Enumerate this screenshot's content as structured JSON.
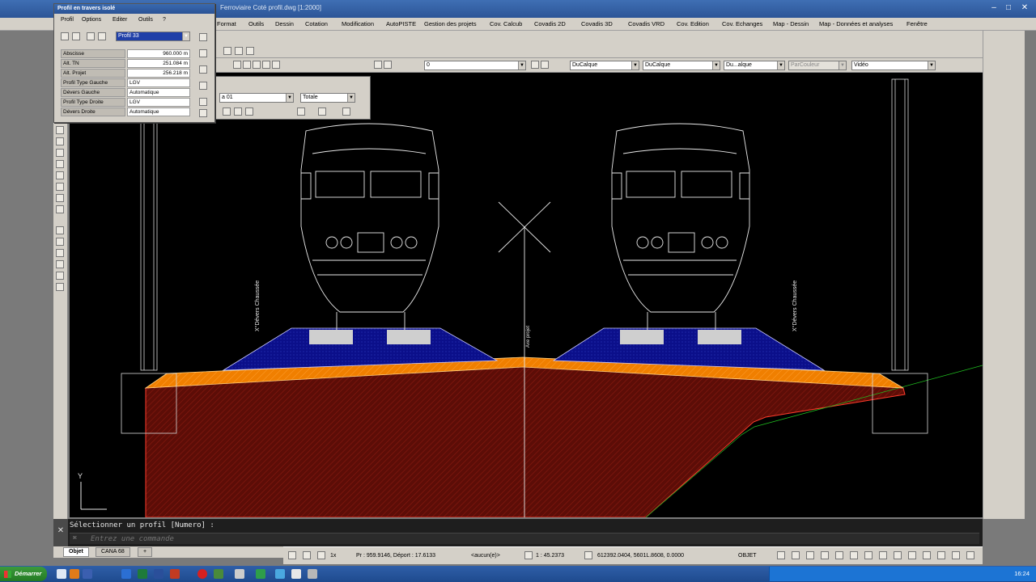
{
  "window": {
    "title": "Ferroviaire Coté profil.dwg [1:2000]",
    "minimize": "–",
    "maximize": "□",
    "close": "✕"
  },
  "menu": [
    "Format",
    "Outils",
    "Dessin",
    "Cotation",
    "Modification",
    "AutoPISTE",
    "Gestion des projets",
    "Cov. Calcub",
    "Covadis 2D",
    "Covadis 3D",
    "Covadis VRD",
    "Cov. Edition",
    "Cov. Echanges",
    "Map - Dessin",
    "Map - Données et analyses",
    "Fenêtre"
  ],
  "toolbar": {
    "layer_combo": "0",
    "color_combo": "DuCalque",
    "linetype_combo": "DuCalque",
    "lineweight_combo": "Du...alque",
    "plotstyle_combo": "ParCouleur",
    "view_combo": "Vidéo"
  },
  "floattb": {
    "combo1": "a 01",
    "combo2": "Totale"
  },
  "profil_panel": {
    "title": "Profil en travers isolé",
    "menu": [
      "Profil",
      "Options",
      "Editer",
      "Outils",
      "?"
    ],
    "profile_combo": "Profil 33",
    "rows": [
      {
        "label": "Abscisse",
        "value": "960.000 m"
      },
      {
        "label": "Alt. TN",
        "value": "251.084 m"
      },
      {
        "label": "Alt. Projet",
        "value": "256.218 m"
      },
      {
        "label": "Profil Type Gauche",
        "value": "LGV"
      },
      {
        "label": "Dévers Gauche",
        "value": "Automatique"
      },
      {
        "label": "Profil Type Droite",
        "value": "LGV"
      },
      {
        "label": "Dévers Droite",
        "value": "Automatique"
      }
    ]
  },
  "drawing": {
    "label_center": "Axe projet",
    "label_left": "X°Dévers Chaussée",
    "label_right": "X°Dévers Chaussée",
    "axis_y": "Y"
  },
  "command": {
    "history": "Sélectionner un profil [Numero] :",
    "prompt": "⌘",
    "placeholder": "Entrez une commande"
  },
  "tabs": [
    "Objet",
    "CANA 68",
    "+"
  ],
  "status": {
    "scale": "1x",
    "coords_pm": "Pr : 959.9146, Déport : 17.6133",
    "snap": "<aucun(e)>",
    "zoom": "1 : 45.2373",
    "coords": "612392.0404, 5601L.8608, 0.0000",
    "mode": "OBJET"
  },
  "taskbar": {
    "start": "Démarrer",
    "clock": "16:24"
  },
  "colors": {
    "ballast": "#0b0f8a",
    "platform": "#f07f00",
    "embankment": "#6a0f08",
    "line": "#e8e8e8"
  }
}
